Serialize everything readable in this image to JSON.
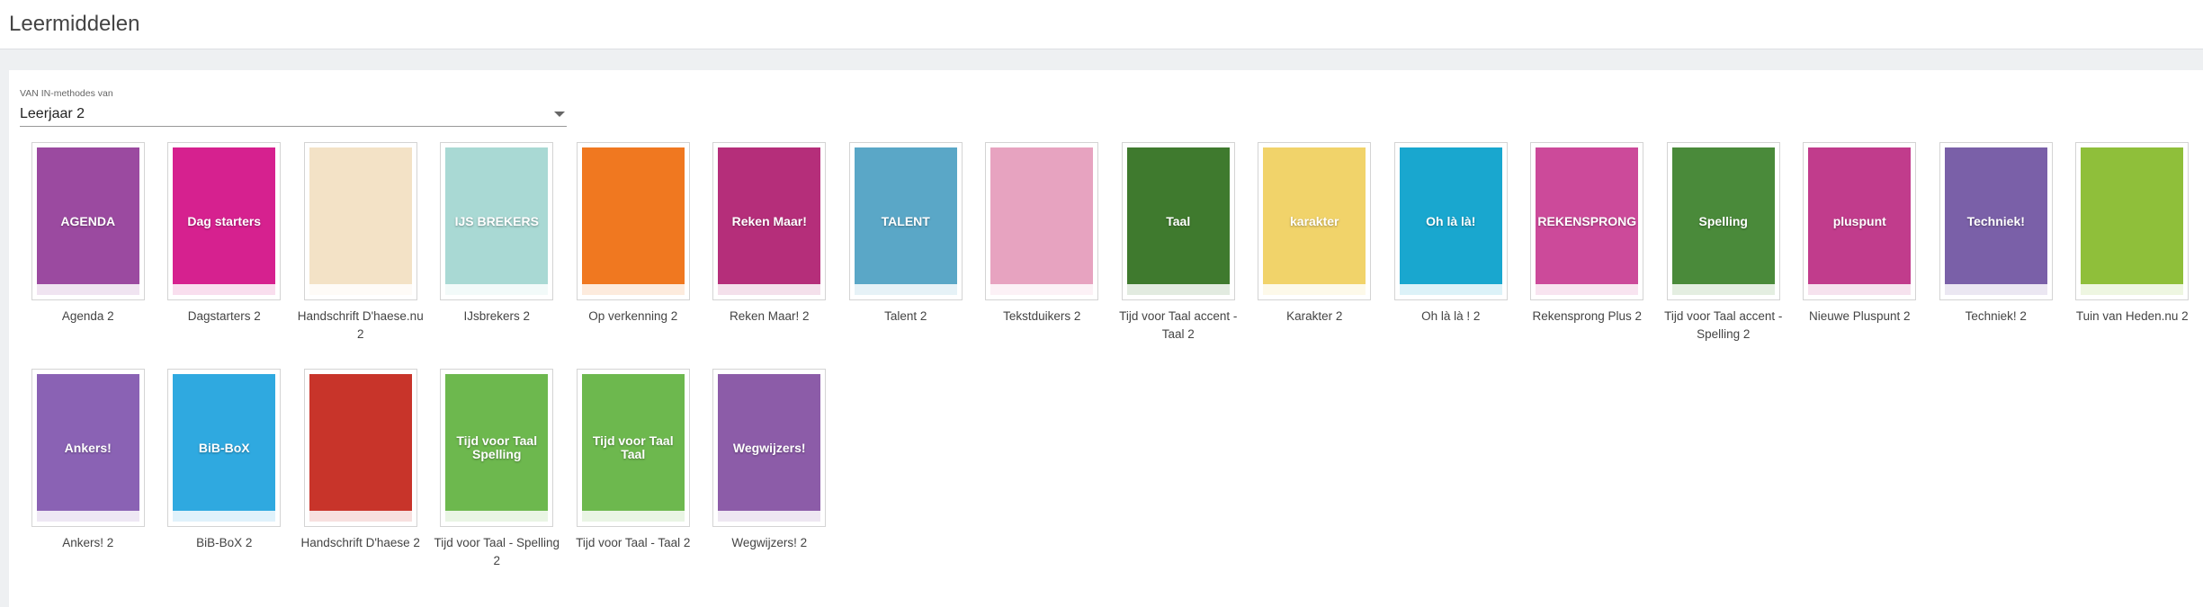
{
  "header": {
    "title": "Leermiddelen"
  },
  "filter": {
    "label": "VAN IN-methodes van",
    "selected": "Leerjaar 2"
  },
  "rows": [
    [
      {
        "label": "Agenda 2",
        "cover": "#9b4aa0",
        "title": "AGENDA"
      },
      {
        "label": "Dagstarters 2",
        "cover": "#d6218f",
        "title": "Dag starters"
      },
      {
        "label": "Handschrift D'haese.nu 2",
        "cover": "#f3e2c6",
        "title": ""
      },
      {
        "label": "IJsbrekers 2",
        "cover": "#a9d9d4",
        "title": "IJS BREKERS"
      },
      {
        "label": "Op verkenning 2",
        "cover": "#f07820",
        "title": ""
      },
      {
        "label": "Reken Maar! 2",
        "cover": "#b52e7a",
        "title": "Reken Maar!"
      },
      {
        "label": "Talent 2",
        "cover": "#5aa7c7",
        "title": "TALENT"
      },
      {
        "label": "Tekstduikers 2",
        "cover": "#e7a3c0",
        "title": ""
      },
      {
        "label": "Tijd voor Taal accent - Taal 2",
        "cover": "#3f7a2e",
        "title": "Taal"
      },
      {
        "label": "Karakter 2",
        "cover": "#f1d36a",
        "title": "karakter"
      },
      {
        "label": "Oh là là ! 2",
        "cover": "#19a7cf",
        "title": "Oh là là!"
      },
      {
        "label": "Rekensprong Plus 2",
        "cover": "#cc4a9a",
        "title": "REKENSPRONG"
      },
      {
        "label": "Tijd voor Taal accent - Spelling 2",
        "cover": "#4a8a3a",
        "title": "Spelling"
      },
      {
        "label": "Nieuwe Pluspunt 2",
        "cover": "#c13c8c",
        "title": "pluspunt"
      },
      {
        "label": "Techniek! 2",
        "cover": "#7a60a8",
        "title": "Techniek!"
      },
      {
        "label": "Tuin van Heden.nu 2",
        "cover": "#8fbf3a",
        "title": ""
      }
    ],
    [
      {
        "label": "Ankers! 2",
        "cover": "#8a62b4",
        "title": "Ankers!"
      },
      {
        "label": "BiB-BoX 2",
        "cover": "#2fa9e0",
        "title": "BiB-BoX"
      },
      {
        "label": "Handschrift D'haese 2",
        "cover": "#c8342a",
        "title": ""
      },
      {
        "label": "Tijd voor Taal - Spelling 2",
        "cover": "#6db84e",
        "title": "Tijd voor Taal Spelling"
      },
      {
        "label": "Tijd voor Taal - Taal 2",
        "cover": "#6db84e",
        "title": "Tijd voor Taal Taal"
      },
      {
        "label": "Wegwijzers! 2",
        "cover": "#8c5ca8",
        "title": "Wegwijzers!"
      }
    ]
  ],
  "icons": {
    "dropdown": "caret-down-icon"
  }
}
